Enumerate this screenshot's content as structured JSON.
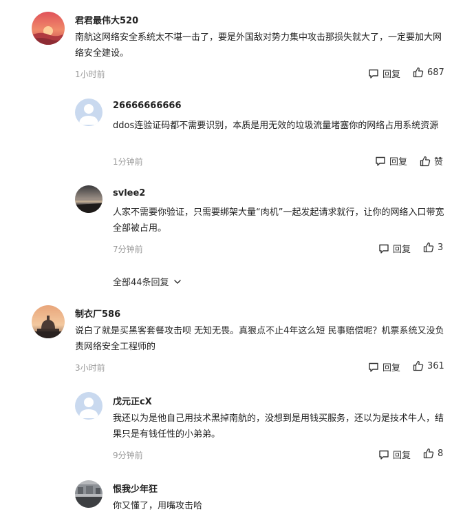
{
  "comments": [
    {
      "user": "君君最伟大520",
      "text": "南航这网络安全系统太不堪一击了，要是外国敌对势力集中攻击那损失就大了，一定要加大网络安全建设。",
      "time": "1小时前",
      "reply_label": "回复",
      "likes": "687",
      "avatar_icon": "sunset-avatar",
      "replies": [
        {
          "user": "26666666666",
          "text": "ddos连验证码都不需要识别，本质是用无效的垃圾流量堵塞你的网络占用系统资源",
          "time": "1分钟前",
          "reply_label": "回复",
          "likes": "赞",
          "avatar_icon": "default-user-avatar"
        },
        {
          "user": "svlee2",
          "text": "人家不需要你验证，只需要绑架大量“肉机”一起发起请求就行，让你的网络入口带宽全部被占用。",
          "time": "7分钟前",
          "reply_label": "回复",
          "likes": "3",
          "avatar_icon": "landscape-avatar"
        }
      ],
      "more_replies": "全部44条回复"
    },
    {
      "user": "制衣厂586",
      "text": "说白了就是买黑客套餐攻击呗 无知无畏。真狠点不止4年这么短 民事赔偿呢？机票系统又没负责网络安全工程师的",
      "time": "3小时前",
      "reply_label": "回复",
      "likes": "361",
      "avatar_icon": "dome-avatar",
      "replies": [
        {
          "user": "戊元正cX",
          "text": "我还以为是他自己用技术黑掉南航的，没想到是用钱买服务，还以为是技术牛人，结果只是有钱任性的小弟弟。",
          "time": "9分钟前",
          "reply_label": "回复",
          "likes": "8",
          "avatar_icon": "default-user-avatar"
        },
        {
          "user": "恨我少年狂",
          "text": "你又懂了，用嘴攻击哈",
          "avatar_icon": "street-avatar"
        }
      ]
    }
  ]
}
